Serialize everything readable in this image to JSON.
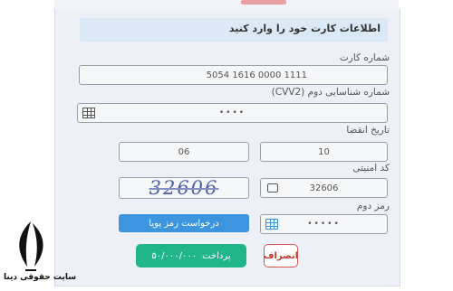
{
  "header": {
    "title": "اطلاعات کارت خود را وارد کنید"
  },
  "card_number": {
    "label": "شماره کارت",
    "value": "5054 1616 0000 1111"
  },
  "cvv2": {
    "label": "شماره شناسایی دوم (CVV2)",
    "value": "••••"
  },
  "expiry": {
    "label": "تاریخ انقضا",
    "month": "10",
    "year": "06"
  },
  "security_code": {
    "label": "کد امنیتی",
    "value": "32606",
    "captcha_text": "32606"
  },
  "second_password": {
    "label": "رمز دوم",
    "value": "•••••",
    "request_button": "درخواست رمز پویا"
  },
  "actions": {
    "pay_label": "پرداخت",
    "pay_amount": "۵۰/۰۰۰/۰۰۰",
    "cancel_label": "انصراف"
  },
  "watermark": {
    "site_name": "سایت حقوقی دینا"
  },
  "colors": {
    "primary_blue": "#3d95e0",
    "pay_green": "#20b58a",
    "cancel_red": "#d9534f",
    "header_bg": "#dbe9f6"
  }
}
